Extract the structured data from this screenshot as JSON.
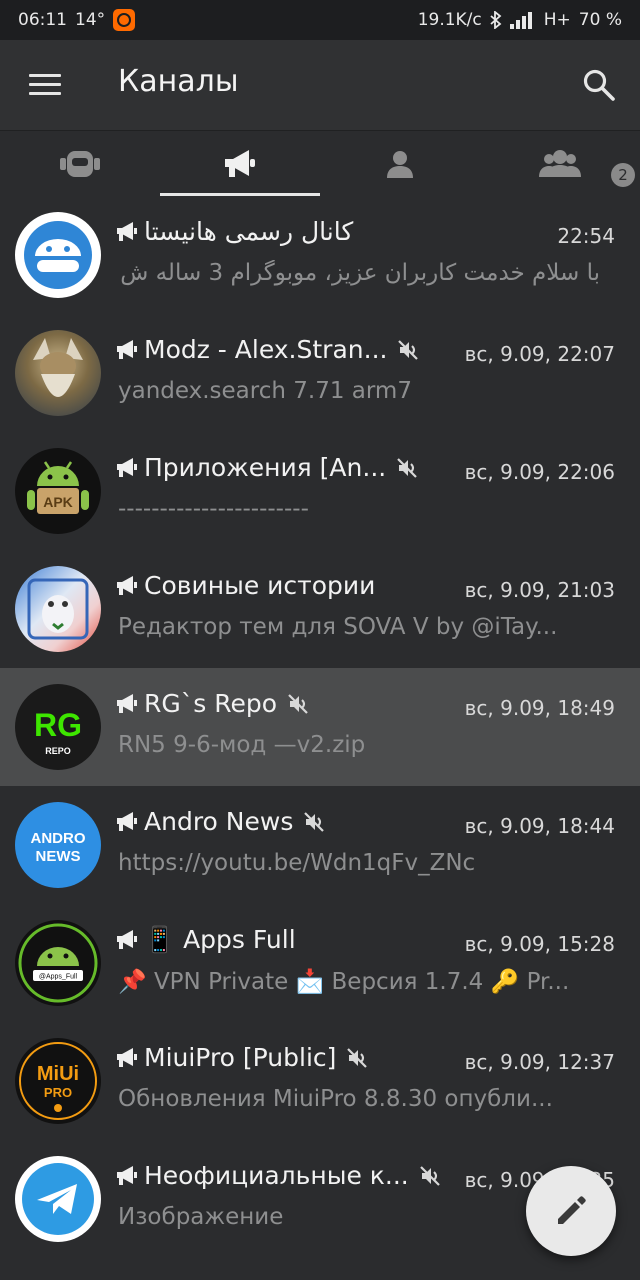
{
  "status": {
    "time": "06:11",
    "temp": "14°",
    "speed": "19.1K/c",
    "network": "H+",
    "battery": "70 %"
  },
  "app_bar": {
    "title": "Каналы"
  },
  "tabs": [
    {
      "icon": "robot-icon"
    },
    {
      "icon": "megaphone-icon",
      "selected": true
    },
    {
      "icon": "person-icon"
    },
    {
      "icon": "group-icon",
      "badge": "2"
    }
  ],
  "chats": [
    {
      "name": "کانال رسمی هانیستا",
      "time": "22:54",
      "preview": "با سلام خدمت کاربران عزیز،  موبوگرام 3 ساله ش...",
      "muted": false,
      "rtl": true,
      "avatar": "hanista"
    },
    {
      "name": "Modz - Alex.Stran...",
      "time": "вс, 9.09, 22:07",
      "preview": "yandex.search 7.71 arm7",
      "muted": true,
      "avatar": "viking"
    },
    {
      "name": "Приложения [An...",
      "time": "вс, 9.09, 22:06",
      "preview": "-----------------------",
      "muted": true,
      "avatar": "apk"
    },
    {
      "name": "Совиные истории",
      "time": "вс, 9.09, 21:03",
      "preview": "Редактор тем для SOVA V by @iTay...",
      "muted": false,
      "avatar": "sova"
    },
    {
      "name": "RG`s Repo",
      "time": "вс, 9.09, 18:49",
      "preview": "RN5 9-6-мод —v2.zip",
      "muted": true,
      "selected": true,
      "avatar": "rg"
    },
    {
      "name": "Andro News",
      "time": "вс, 9.09, 18:44",
      "preview": "https://youtu.be/Wdn1qFv_ZNc",
      "muted": true,
      "avatar": "andronews"
    },
    {
      "name": "📱 Apps Full",
      "time": "вс, 9.09, 15:28",
      "preview": "📌 VPN Private 📩 Версия 1.7.4 🔑 Pr...",
      "muted": false,
      "avatar": "appsfull"
    },
    {
      "name": "MiuiPro [Public]",
      "time": "вс, 9.09, 12:37",
      "preview": "Обновления MiuiPro 8.8.30 опубли...",
      "muted": true,
      "avatar": "miuipro"
    },
    {
      "name": "Неофициальные к...",
      "time": "вс, 9.09, 12:35",
      "preview": "Изображение",
      "muted": true,
      "avatar": "telegram"
    }
  ],
  "avatar_labels": {
    "apk": "APK",
    "rg": "RG",
    "rg_sub": "REPO",
    "andro_1": "ANDRO",
    "andro_2": "NEWS",
    "apps_full_tag": "@Apps_Full",
    "miui_1": "MiUi",
    "miui_2": "PRO"
  },
  "fab": {
    "icon": "pencil-icon"
  }
}
